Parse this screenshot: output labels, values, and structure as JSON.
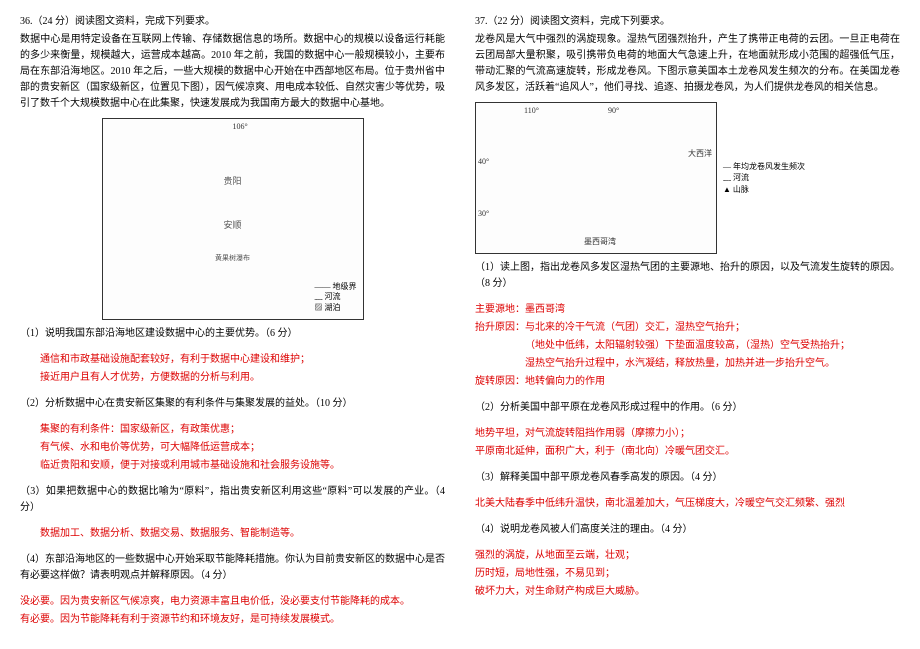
{
  "left": {
    "q_header": "36.（24 分）阅读图文资料，完成下列要求。",
    "intro": "数据中心是用特定设备在互联网上传输、存储数据信息的场所。数据中心的规模以设备运行耗能的多少来衡量，规模越大，运营成本越高。2010 年之前，我国的数据中心一般规模较小，主要布局在东部沿海地区。2010 年之后，一些大规模的数据中心开始在中西部地区布局。位于贵州省中部的贵安新区（国家级新区，位置见下图），因气候凉爽、用电成本较低、自然灾害少等优势，吸引了数千个大规模数据中心在此集聚，快速发展成为我国南方最大的数据中心基地。",
    "map1_lon": "106°",
    "map1_city1": "贵阳",
    "map1_city2": "安顺",
    "map1_river": "黄果树瀑布",
    "legend1_a": "—— 地级界",
    "legend1_b": "﹏  河流",
    "legend1_c": "▨  湖泊",
    "q1": "（1）说明我国东部沿海地区建设数据中心的主要优势。（6 分）",
    "a1_l1": "通信和市政基础设施配套较好，有利于数据中心建设和维护；",
    "a1_l2": "接近用户且有人才优势，方便数据的分析与利用。",
    "q2": "（2）分析数据中心在贵安新区集聚的有利条件与集聚发展的益处。（10 分）",
    "a2_l1": "集聚的有利条件：国家级新区，有政策优惠；",
    "a2_l2": "有气候、水和电价等优势，可大幅降低运营成本；",
    "a2_l3": "临近贵阳和安顺，便于对接或利用城市基础设施和社会服务设施等。",
    "q3": "（3）如果把数据中心的数据比喻为“原料”，指出贵安新区利用这些“原料”可以发展的产业。（4 分）",
    "a3": "数据加工、数据分析、数据交易、数据服务、智能制造等。",
    "q4": "（4）东部沿海地区的一些数据中心开始采取节能降耗措施。你认为目前贵安新区的数据中心是否有必要这样做？请表明观点并解释原因。（4 分）",
    "a4_l1": "没必要。因为贵安新区气候凉爽，电力资源丰富且电价低，没必要支付节能降耗的成本。",
    "a4_l2": "有必要。因为节能降耗有利于资源节约和环境友好，是可持续发展模式。"
  },
  "right": {
    "q_header": "37.（22 分）阅读图文资料，完成下列要求。",
    "intro": "龙卷风是大气中强烈的涡旋现象。湿热气团强烈抬升，产生了携带正电荷的云团。一旦正电荷在云团局部大量积聚，吸引携带负电荷的地面大气急速上升，在地面就形成小范围的超强低气压，带动汇聚的气流高速旋转，形成龙卷风。下图示意美国本土龙卷风发生频次的分布。在美国龙卷风多发区，活跃着“追风人”，他们寻找、追逐、拍摄龙卷风，为人们提供龙卷风的相关信息。",
    "map2_lon1": "110°",
    "map2_lon2": "90°",
    "map2_lat1": "40°",
    "map2_lat2": "30°",
    "map2_sea": "墨西哥湾",
    "map2_canada": "大西洋",
    "legend2_a": "— 年均龙卷风发生频次",
    "legend2_b": "﹏ 河流",
    "legend2_c": "▲ 山脉",
    "q1": "（1）读上图，指出龙卷风多发区湿热气团的主要源地、抬升的原因，以及气流发生旋转的原因。（8 分）",
    "a1_l1": "主要源地：墨西哥湾",
    "a1_l2": "抬升原因：与北来的冷干气流（气团）交汇，湿热空气抬升；",
    "a1_l3": "（地处中低纬，太阳辐射较强）下垫面温度较高，（湿热）空气受热抬升；",
    "a1_l4": "湿热空气抬升过程中，水汽凝结，释放热量，加热并进一步抬升空气。",
    "a1_l5": "旋转原因：地转偏向力的作用",
    "q2": "（2）分析美国中部平原在龙卷风形成过程中的作用。（6 分）",
    "a2_l1": "地势平坦，对气流旋转阻挡作用弱（摩擦力小）；",
    "a2_l2": "平原南北延伸，面积广大，利于（南北向）冷暖气团交汇。",
    "q3": "（3）解释美国中部平原龙卷风春季高发的原因。（4 分）",
    "a3": "北美大陆春季中低纬升温快，南北温差加大，气压梯度大，冷暖空气交汇频繁、强烈",
    "q4": "（4）说明龙卷风被人们高度关注的理由。（4 分）",
    "a4_l1": "强烈的涡旋，从地面至云端，壮观；",
    "a4_l2": "历时短，局地性强，不易见到；",
    "a4_l3": "破坏力大，对生命财产构成巨大威胁。"
  }
}
